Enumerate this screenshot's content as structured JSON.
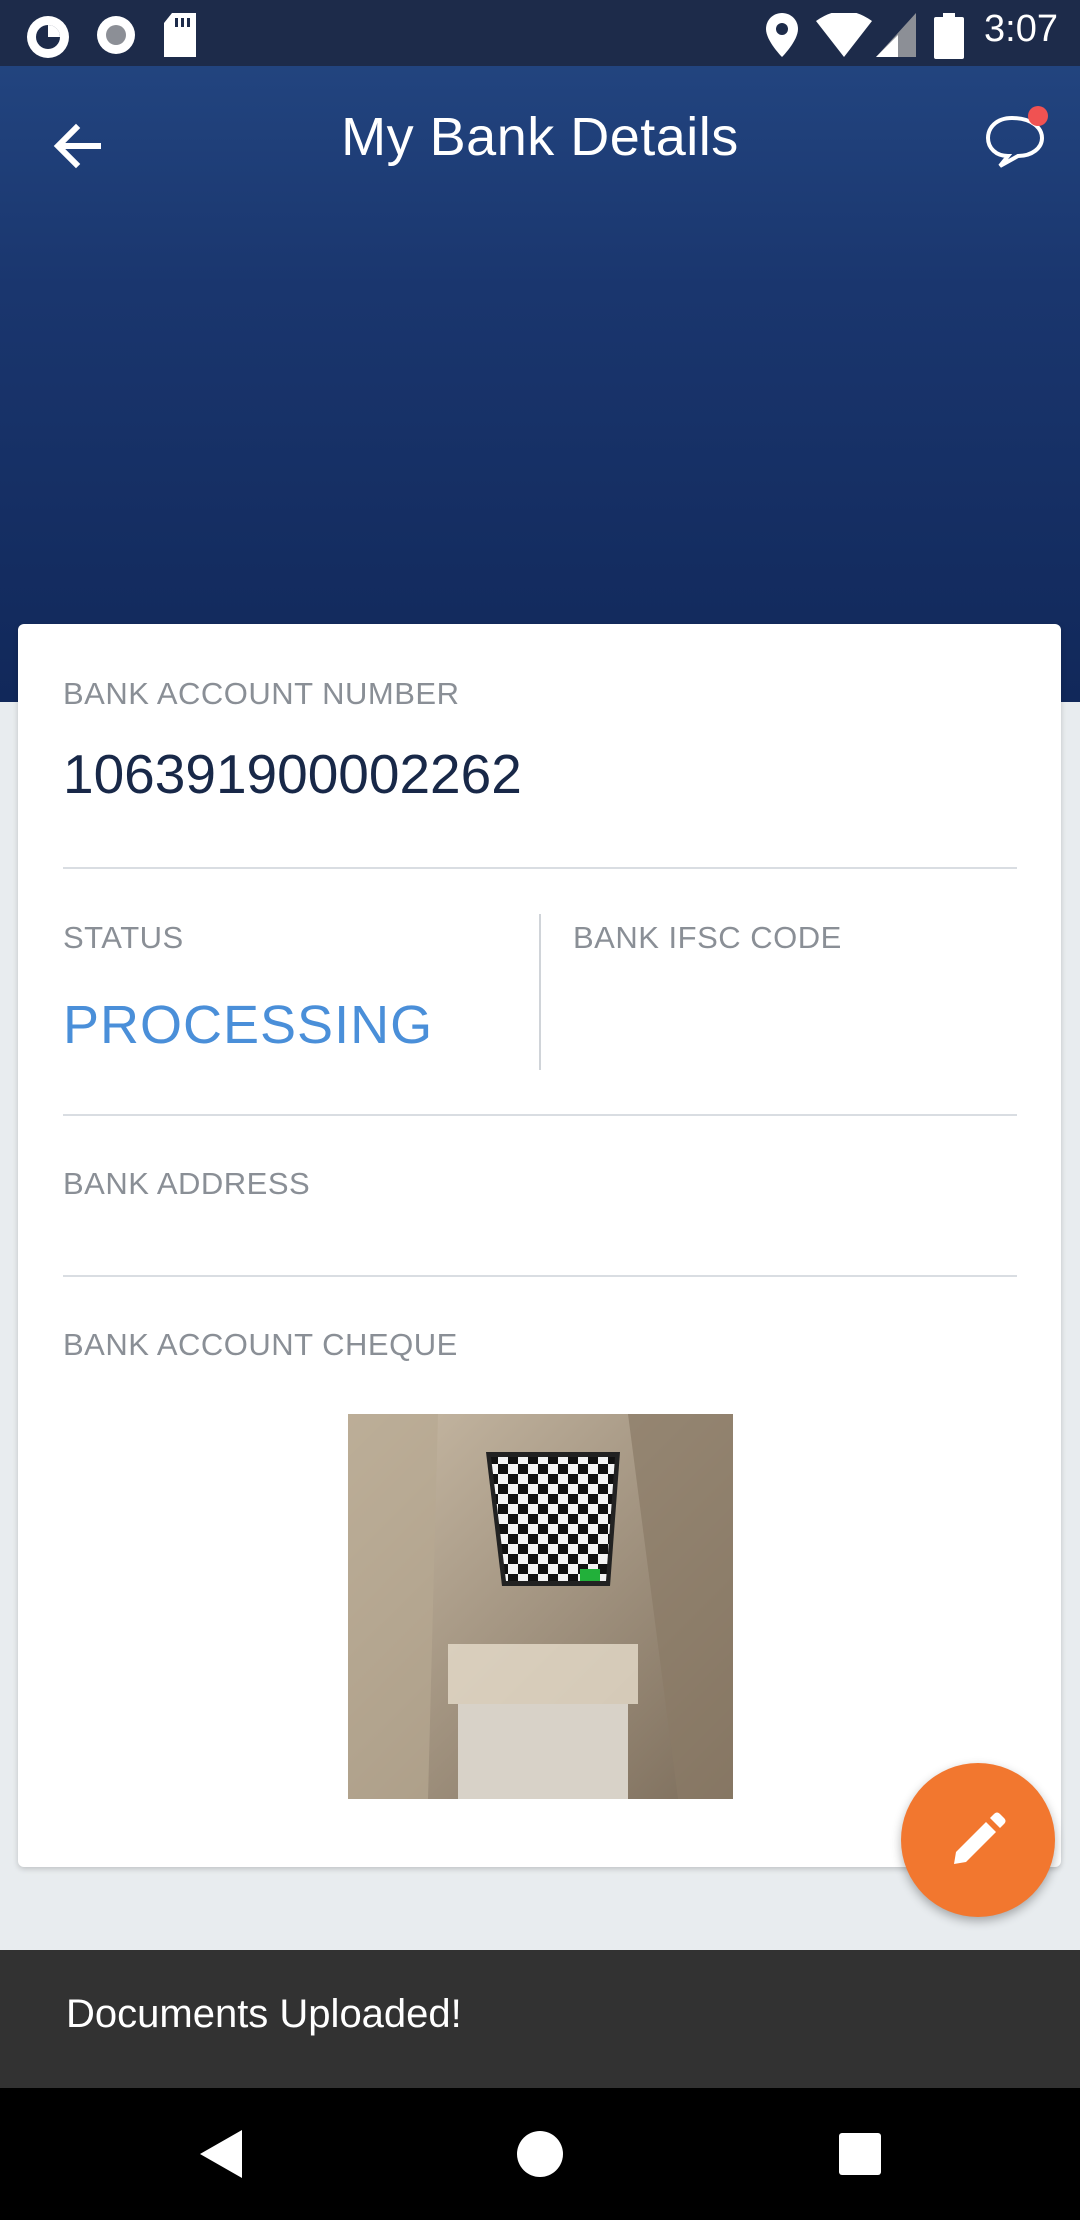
{
  "status_bar": {
    "time": "3:07",
    "icons": [
      "app-icon",
      "record-icon",
      "sd-card-icon",
      "location-icon",
      "wifi-icon",
      "signal-icon",
      "battery-icon"
    ]
  },
  "header": {
    "title": "My Bank Details",
    "back_icon": "arrow-left-icon",
    "chat_icon": "chat-bubble-icon",
    "colors": {
      "gradient_top": "#22447f",
      "gradient_bottom": "#11285a"
    }
  },
  "card": {
    "account_number_label": "BANK ACCOUNT NUMBER",
    "account_number": "106391900002262",
    "status_label": "STATUS",
    "status_value": "PROCESSING",
    "status_color": "#4a8fd9",
    "ifsc_label": "BANK IFSC CODE",
    "ifsc_value": "",
    "address_label": "BANK ADDRESS",
    "address_value": "",
    "cheque_label": "BANK ACCOUNT CHEQUE"
  },
  "fab": {
    "icon": "pencil-icon",
    "color": "#f2772f"
  },
  "snackbar": {
    "message": "Documents Uploaded!"
  },
  "nav_bar": {
    "icons": [
      "back-triangle-icon",
      "home-circle-icon",
      "recents-square-icon"
    ]
  }
}
